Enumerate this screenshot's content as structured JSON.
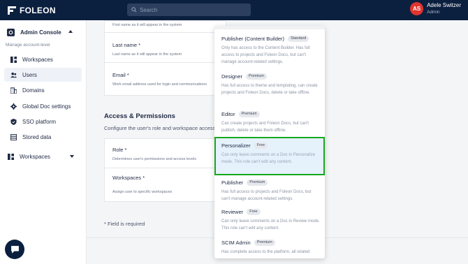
{
  "topbar": {
    "brand": "FOLEON",
    "search_placeholder": "Search",
    "user_initials": "AS",
    "user_name": "Adele Switzer",
    "user_role": "Admin"
  },
  "sidebar": {
    "console_label": "Admin Console",
    "section_label": "Manage account-level",
    "items": [
      {
        "label": "Workspaces",
        "icon": "grid-icon"
      },
      {
        "label": "Users",
        "icon": "users-icon"
      },
      {
        "label": "Domains",
        "icon": "building-icon"
      },
      {
        "label": "Global Doc settings",
        "icon": "gear-icon"
      },
      {
        "label": "SSO platform",
        "icon": "shield-icon"
      },
      {
        "label": "Stored data",
        "icon": "database-icon"
      }
    ],
    "workspaces_toggle": "Workspaces"
  },
  "form": {
    "first_name_help": "First name as it will appear in the system",
    "last_name_label": "Last name *",
    "last_name_help": "Last name as it will appear in the system",
    "email_label": "Email *",
    "email_help": "Work email address used for login and communications",
    "access_title": "Access & Permissions",
    "access_sub": "Configure the user's role and workspace access",
    "role_label": "Role *",
    "role_help": "Determines user's permissions and access levels",
    "workspaces_label": "Workspaces *",
    "workspaces_help": "Assign user to specific workspaces",
    "required_note": "* Field is required"
  },
  "role_options": [
    {
      "name": "Publisher (Content Builder)",
      "badge": "Standard",
      "desc": "Only has access to the Content Builder. Has full access to projects and Foleon Docs, but can't manage account-related settings."
    },
    {
      "name": "Designer",
      "badge": "Premium",
      "desc": "Has full access to theme and templating, can create projects and Foleon Docs, delete or take offline."
    },
    {
      "name": "Editor",
      "badge": "Premium",
      "desc": "Can create projects and Foleon Docs, but can't publish, delete or take them offline."
    },
    {
      "name": "Personalizer",
      "badge": "Free",
      "desc": "Can only leave comments on a Doc in Personalize mode. This role can't edit any content."
    },
    {
      "name": "Publisher",
      "badge": "Premium",
      "desc": "Has full access to projects and Foleon Docs, but can't manage account-related settings."
    },
    {
      "name": "Reviewer",
      "badge": "Free",
      "desc": "Can only leave comments on a Doc in Review mode. This role can't edit any content."
    },
    {
      "name": "SCIM Admin",
      "badge": "Premium",
      "desc": "Has complete access to the platform, all related"
    }
  ],
  "colors": {
    "topbar": "#0b1f3f",
    "selected_border": "#16a91e",
    "selected_bg": "#e5f1fb",
    "avatar": "#e1352f"
  }
}
